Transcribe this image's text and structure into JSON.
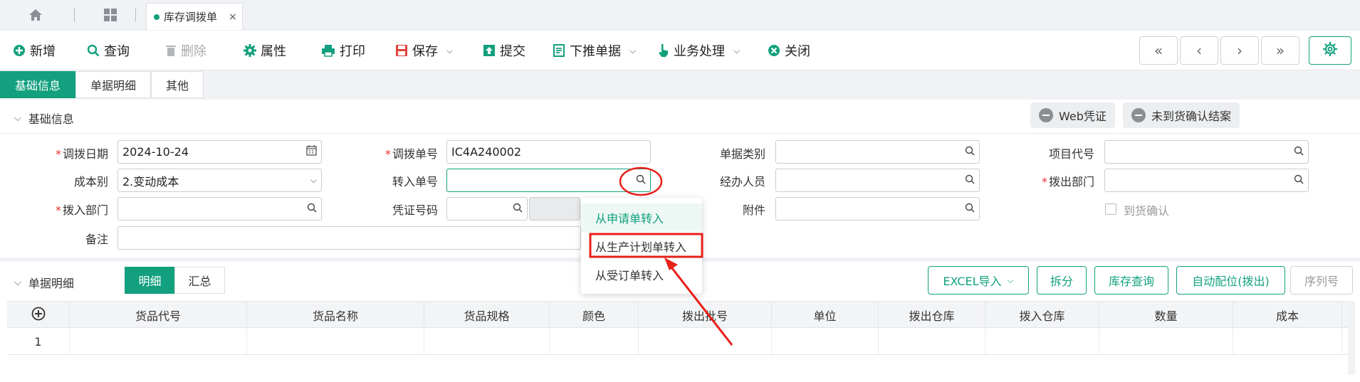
{
  "topbar": {
    "doc_tab_label": "库存调拨单",
    "doc_tab_close": "×"
  },
  "toolbar": {
    "new": "新增",
    "query": "查询",
    "delete": "删除",
    "props": "属性",
    "print": "打印",
    "save": "保存",
    "submit": "提交",
    "push_down": "下推单据",
    "business": "业务处理",
    "close": "关闭",
    "nav": [
      "«",
      "‹",
      "›",
      "»"
    ]
  },
  "section_tabs": [
    "基础信息",
    "单据明细",
    "其他"
  ],
  "basic": {
    "title": "基础信息",
    "web_voucher": "Web凭证",
    "unarrived_confirm": "未到货确认结案",
    "labels": {
      "transfer_date": "调拨日期",
      "transfer_no": "调拨单号",
      "doc_type": "单据类别",
      "project_code": "项目代号",
      "cost_type": "成本别",
      "in_doc_no": "转入单号",
      "handler": "经办人员",
      "out_dept": "拨出部门",
      "in_dept": "拨入部门",
      "voucher_no": "凭证号码",
      "attachment": "附件",
      "arrival_confirm": "到货确认",
      "remark": "备注"
    },
    "values": {
      "transfer_date": "2024-10-24",
      "transfer_no": "IC4A240002",
      "cost_type": "2.变动成本"
    }
  },
  "dropdown": {
    "items": [
      "从申请单转入",
      "从生产计划单转入",
      "从受订单转入"
    ]
  },
  "detail": {
    "title": "单据明细",
    "views": [
      "明细",
      "汇总"
    ],
    "buttons": {
      "excel": "EXCEL导入",
      "split": "拆分",
      "stock_query": "库存查询",
      "auto_alloc": "自动配位(拨出)",
      "serial": "序列号"
    },
    "columns": [
      "货品代号",
      "货品名称",
      "货品规格",
      "颜色",
      "拨出批号",
      "单位",
      "拨出仓库",
      "拨入仓库",
      "数量",
      "成本"
    ],
    "rows": [
      {
        "index": "1"
      }
    ]
  },
  "colors": {
    "accent": "#12a07e",
    "required": "#e3342f",
    "annotation": "#e8201a"
  }
}
